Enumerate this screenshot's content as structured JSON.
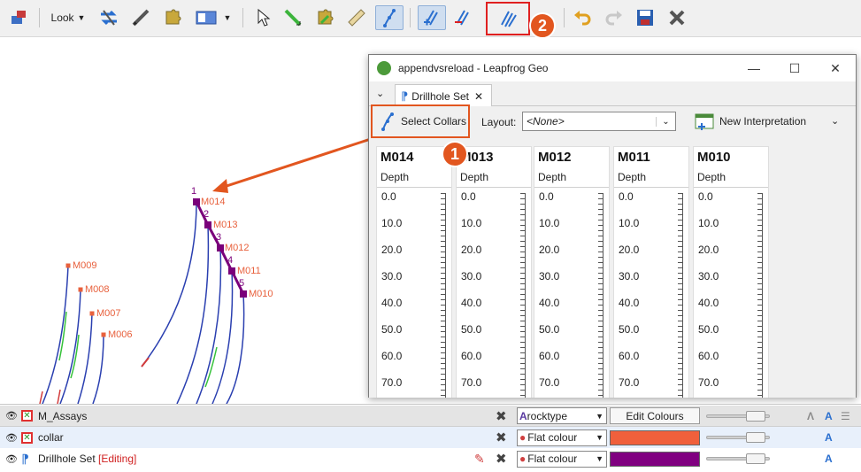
{
  "toolbar": {
    "look_label": "Look"
  },
  "scene": {
    "holes": [
      {
        "name": "M009",
        "order": ""
      },
      {
        "name": "M008",
        "order": ""
      },
      {
        "name": "M007",
        "order": ""
      },
      {
        "name": "M006",
        "order": ""
      },
      {
        "name": "M014",
        "order": "1"
      },
      {
        "name": "M013",
        "order": "2"
      },
      {
        "name": "M012",
        "order": "3"
      },
      {
        "name": "M011",
        "order": "4"
      },
      {
        "name": "M010",
        "order": "5"
      }
    ],
    "colors": {
      "collar": "#e8603c",
      "selected": "#7a007a",
      "trace": "#2a3fb0",
      "green": "#36c23a"
    }
  },
  "window": {
    "title": "appendvsreload - Leapfrog Geo",
    "tab_label": "Drillhole Set",
    "select_collars_label": "Select Collars",
    "layout_label": "Layout:",
    "layout_value": "<None>",
    "new_interpretation_label": "New Interpretation",
    "columns": [
      {
        "name": "M014",
        "depth_label": "Depth"
      },
      {
        "name": "M013",
        "depth_label": "Depth"
      },
      {
        "name": "M012",
        "depth_label": "Depth"
      },
      {
        "name": "M011",
        "depth_label": "Depth"
      },
      {
        "name": "M010",
        "depth_label": "Depth"
      }
    ],
    "depths": [
      "0.0",
      "10.0",
      "20.0",
      "30.0",
      "40.0",
      "50.0",
      "60.0",
      "70.0"
    ]
  },
  "callouts": {
    "one": "1",
    "two": "2"
  },
  "layers": [
    {
      "name": "M_Assays",
      "editing": "",
      "style": "rocktype",
      "extra": "Edit Colours",
      "color": ""
    },
    {
      "name": "collar",
      "editing": "",
      "style": "Flat colour",
      "extra": "",
      "color": "#f0603c"
    },
    {
      "name": "Drillhole Set",
      "editing": "[Editing]",
      "style": "Flat colour",
      "extra": "",
      "color": "#800080"
    }
  ]
}
